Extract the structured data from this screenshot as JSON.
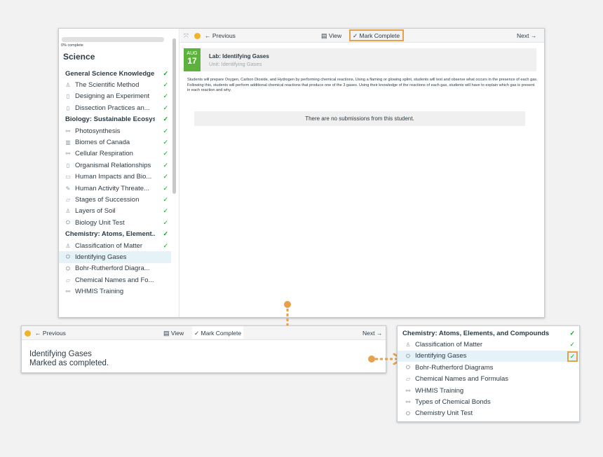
{
  "sidebar": {
    "progress_label": "0% complete",
    "progress_value": 0,
    "title": "Science",
    "items": [
      {
        "label": "General Science Knowledge",
        "type": "heading",
        "icon": "",
        "check": "✓"
      },
      {
        "label": "The Scientific Method",
        "type": "item",
        "icon": "users-icon",
        "check": "✓"
      },
      {
        "label": "Designing an Experiment",
        "type": "item",
        "icon": "page-icon",
        "check": "✓"
      },
      {
        "label": "Dissection Practices an...",
        "type": "item",
        "icon": "page-icon",
        "check": "✓"
      },
      {
        "label": "Biology: Sustainable Ecosys...",
        "type": "heading",
        "icon": "",
        "check": "✓"
      },
      {
        "label": "Photosynthesis",
        "type": "item",
        "icon": "link-icon",
        "check": "✓"
      },
      {
        "label": "Biomes of Canada",
        "type": "item",
        "icon": "chart-icon",
        "check": "✓"
      },
      {
        "label": "Cellular Respiration",
        "type": "item",
        "icon": "link-icon",
        "check": "✓"
      },
      {
        "label": "Organismal Relationships",
        "type": "item",
        "icon": "page-icon",
        "check": "✓"
      },
      {
        "label": "Human Impacts and Bio...",
        "type": "item",
        "icon": "image-icon",
        "check": "✓"
      },
      {
        "label": "Human Activity Threate...",
        "type": "item",
        "icon": "edit-icon",
        "check": "✓"
      },
      {
        "label": "Stages of Succession",
        "type": "item",
        "icon": "chat-icon",
        "check": "✓"
      },
      {
        "label": "Layers of Soil",
        "type": "item",
        "icon": "users-icon",
        "check": "✓"
      },
      {
        "label": "Biology Unit Test",
        "type": "item",
        "icon": "cap-icon",
        "check": "✓"
      },
      {
        "label": "Chemistry: Atoms, Element...",
        "type": "heading",
        "icon": "",
        "check": "✓"
      },
      {
        "label": "Classification of Matter",
        "type": "item",
        "icon": "users-icon",
        "check": "✓"
      },
      {
        "label": "Identifying Gases",
        "type": "item",
        "icon": "cap-icon",
        "check": "",
        "active": true
      },
      {
        "label": "Bohr-Rutherford Diagra...",
        "type": "item",
        "icon": "cap-icon",
        "check": ""
      },
      {
        "label": "Chemical Names and Fo...",
        "type": "item",
        "icon": "chat-icon",
        "check": ""
      },
      {
        "label": "WHMIS Training",
        "type": "item",
        "icon": "link-icon",
        "check": ""
      }
    ]
  },
  "toolbar": {
    "previous_label": "← Previous",
    "view_label": "View",
    "mark_complete_label": "✓ Mark Complete",
    "next_label": "Next →"
  },
  "assignment": {
    "month": "AUG",
    "day": "17",
    "title": "Lab: Identifying Gases",
    "unit": "Unit: Identifying Gases",
    "description": "Students will prepare Oxygen, Carbon Dioxide, and Hydrogen by performing chemical reactions. Using a flaming or glowing splint, students will test and observe what occurs in the presence of each gas.\nFollowing this, students will perform additional chemical reactions that produce one of the 3 gases. Using their knowledge of the reactions of each gas, students will have to explain which gas is present in each reaction and why.",
    "no_submissions": "There are no submissions from this student."
  },
  "bottom_panel": {
    "previous_label": "← Previous",
    "view_label": "View",
    "mark_complete_label": "✓ Mark Complete",
    "next_label": "Next →",
    "message_title": "Identifying Gases",
    "message_status": "Marked as completed."
  },
  "right_panel": {
    "items": [
      {
        "label": "Chemistry: Atoms, Elements, and Compounds",
        "type": "heading",
        "icon": "",
        "check": "✓"
      },
      {
        "label": "Classification of Matter",
        "type": "item",
        "icon": "users-icon",
        "check": "✓"
      },
      {
        "label": "Identifying Gases",
        "type": "item",
        "icon": "cap-icon",
        "check": "✓",
        "active": true,
        "highlight": true
      },
      {
        "label": "Bohr-Rutherford Diagrams",
        "type": "item",
        "icon": "cap-icon",
        "check": ""
      },
      {
        "label": "Chemical Names and Formulas",
        "type": "item",
        "icon": "chat-icon",
        "check": ""
      },
      {
        "label": "WHMIS Training",
        "type": "item",
        "icon": "link-icon",
        "check": ""
      },
      {
        "label": "Types of Chemical Bonds",
        "type": "item",
        "icon": "link-icon",
        "check": ""
      },
      {
        "label": "Chemistry Unit Test",
        "type": "item",
        "icon": "cap-icon",
        "check": ""
      }
    ]
  },
  "colors": {
    "accent_orange": "#e6a14b",
    "check_green": "#00ac18",
    "date_green": "#5cb23c",
    "active_row": "#e5f2f8"
  }
}
